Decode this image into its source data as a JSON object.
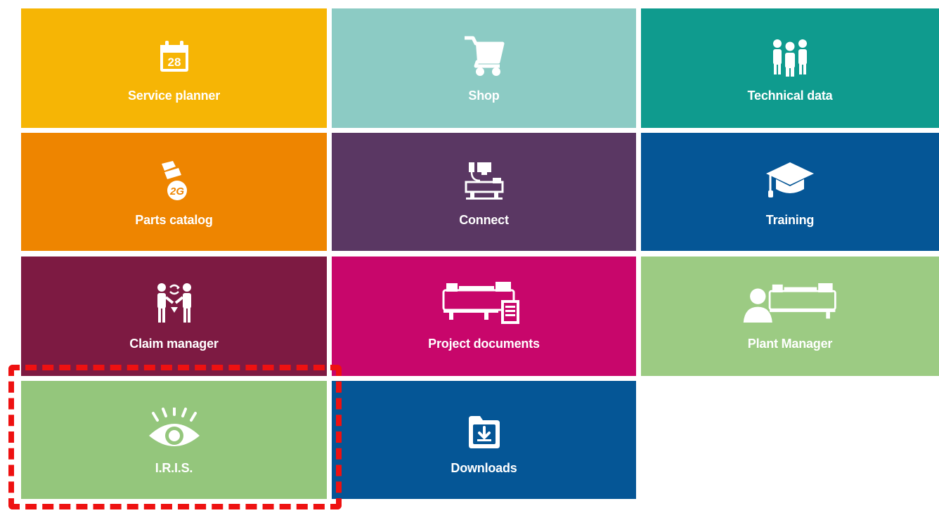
{
  "dashboard": {
    "tiles": [
      {
        "label": "Service planner",
        "icon": "calendar-icon",
        "icon_text": "28",
        "color": "#f6b505"
      },
      {
        "label": "Shop",
        "icon": "shopping-cart-icon",
        "color": "#8ccbc4"
      },
      {
        "label": "Technical data",
        "icon": "team-icon",
        "color": "#0f9b8e"
      },
      {
        "label": "Parts catalog",
        "icon": "parts-icon",
        "icon_text": "2G",
        "color": "#ee8500"
      },
      {
        "label": "Connect",
        "icon": "connected-machine-icon",
        "color": "#5a3763"
      },
      {
        "label": "Training",
        "icon": "graduation-cap-icon",
        "color": "#055696"
      },
      {
        "label": "Claim manager",
        "icon": "claim-exchange-icon",
        "color": "#7d1a42"
      },
      {
        "label": "Project documents",
        "icon": "machine-documents-icon",
        "color": "#c8066b"
      },
      {
        "label": "Plant Manager",
        "icon": "plant-manager-icon",
        "color": "#9ccb83"
      },
      {
        "label": "I.R.I.S.",
        "icon": "eye-icon",
        "color": "#94c67c"
      },
      {
        "label": "Downloads",
        "icon": "download-folder-icon",
        "color": "#055696"
      }
    ],
    "highlight": {
      "target": "I.R.I.S.",
      "color": "#ee1111"
    }
  }
}
